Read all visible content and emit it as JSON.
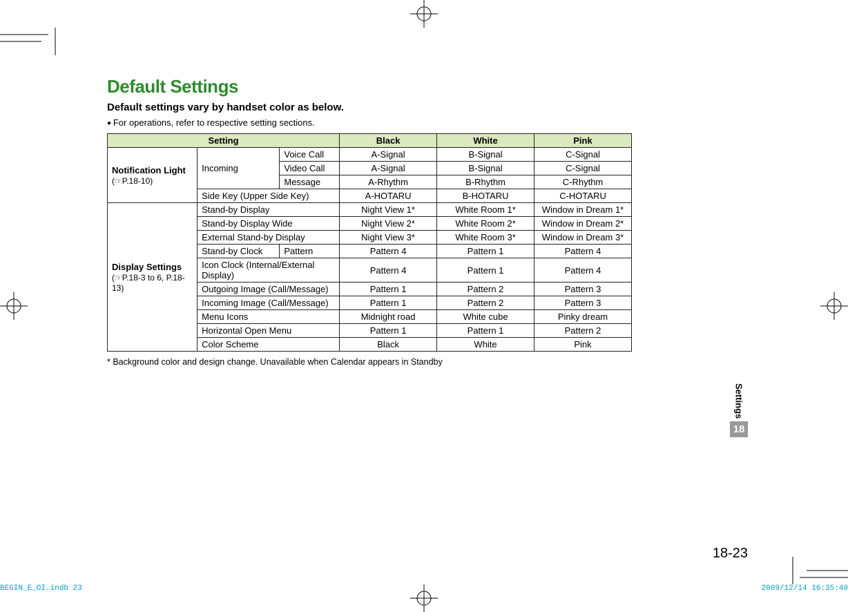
{
  "title": "Default Settings",
  "subtitle": "Default settings vary by handset color as below.",
  "bullet": "For operations, refer to respective setting sections.",
  "headers": {
    "setting": "Setting",
    "black": "Black",
    "white": "White",
    "pink": "Pink"
  },
  "section_a": {
    "label_strong": "Notification Light",
    "label_ref": "(☞P.18-10)",
    "incoming": "Incoming",
    "rows": {
      "voice": {
        "label": "Voice Call",
        "b": "A-Signal",
        "w": "B-Signal",
        "p": "C-Signal"
      },
      "video": {
        "label": "Video Call",
        "b": "A-Signal",
        "w": "B-Signal",
        "p": "C-Signal"
      },
      "msg": {
        "label": "Message",
        "b": "A-Rhythm",
        "w": "B-Rhythm",
        "p": "C-Rhythm"
      },
      "side": {
        "label": "Side Key (Upper Side Key)",
        "b": "A-HOTARU",
        "w": "B-HOTARU",
        "p": "C-HOTARU"
      }
    }
  },
  "section_b": {
    "label_strong": "Display Settings",
    "label_ref": "(☞P.18-3 to 6, P.18-13)",
    "rows": [
      {
        "label": "Stand-by Display",
        "b": "Night View 1*",
        "w": "White Room 1*",
        "p": "Window in Dream 1*"
      },
      {
        "label": "Stand-by Display Wide",
        "b": "Night View 2*",
        "w": "White Room 2*",
        "p": "Window in Dream 2*"
      },
      {
        "label": "External Stand-by Display",
        "b": "Night View 3*",
        "w": "White Room 3*",
        "p": "Window in Dream 3*"
      }
    ],
    "clock": {
      "label": "Stand-by Clock",
      "sub": "Pattern",
      "b": "Pattern 4",
      "w": "Pattern 1",
      "p": "Pattern 4"
    },
    "more": [
      {
        "label": "Icon Clock (Internal/External Display)",
        "b": "Pattern 4",
        "w": "Pattern 1",
        "p": "Pattern 4"
      },
      {
        "label": "Outgoing Image (Call/Message)",
        "b": "Pattern 1",
        "w": "Pattern 2",
        "p": "Pattern 3"
      },
      {
        "label": "Incoming Image (Call/Message)",
        "b": "Pattern 1",
        "w": "Pattern 2",
        "p": "Pattern 3"
      },
      {
        "label": "Menu Icons",
        "b": "Midnight road",
        "w": "White cube",
        "p": "Pinky dream"
      },
      {
        "label": "Horizontal Open Menu",
        "b": "Pattern 1",
        "w": "Pattern 1",
        "p": "Pattern 2"
      },
      {
        "label": "Color Scheme",
        "b": "Black",
        "w": "White",
        "p": "Pink"
      }
    ]
  },
  "footnote": "* Background color and design change. Unavailable when Calendar appears in Standby",
  "side_label": "Settings",
  "chapter": "18",
  "page": "18-23",
  "footer_left": "BEGIN_E_OI.indb   23",
  "footer_right": "2009/12/14   16:35:40"
}
